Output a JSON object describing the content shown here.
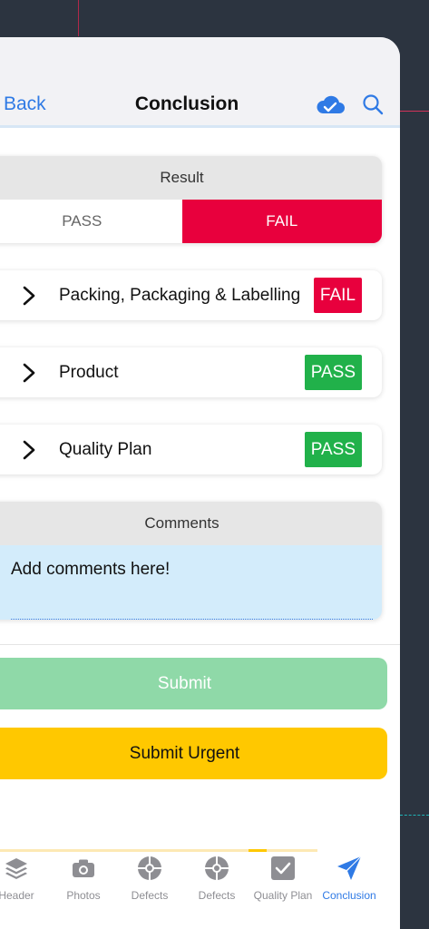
{
  "header": {
    "back_label": "Back",
    "title": "Conclusion",
    "cloud_icon": "cloud-check-icon",
    "search_icon": "search-icon"
  },
  "result": {
    "heading": "Result",
    "options": [
      "PASS",
      "FAIL"
    ],
    "selected": "FAIL"
  },
  "sections": [
    {
      "label": "Packing, Packaging & Labelling",
      "status": "FAIL"
    },
    {
      "label": "Product",
      "status": "PASS"
    },
    {
      "label": "Quality Plan",
      "status": "PASS"
    }
  ],
  "comments": {
    "heading": "Comments",
    "placeholder": "Add comments here!"
  },
  "actions": {
    "submit_label": "Submit",
    "submit_urgent_label": "Submit Urgent"
  },
  "tabs": [
    {
      "label": "Header",
      "icon": "layers-icon"
    },
    {
      "label": "Photos",
      "icon": "camera-icon"
    },
    {
      "label": "Defects",
      "icon": "target-icon"
    },
    {
      "label": "Defects",
      "icon": "target-icon"
    },
    {
      "label": "Quality Plan",
      "icon": "checkbox-icon"
    },
    {
      "label": "Conclusion",
      "icon": "paper-plane-icon",
      "active": true
    }
  ],
  "colors": {
    "accent": "#2f7ae5",
    "fail": "#e8003d",
    "pass": "#21b14a",
    "urgent": "#ffc800",
    "submit_disabled": "#8fd9a8"
  }
}
